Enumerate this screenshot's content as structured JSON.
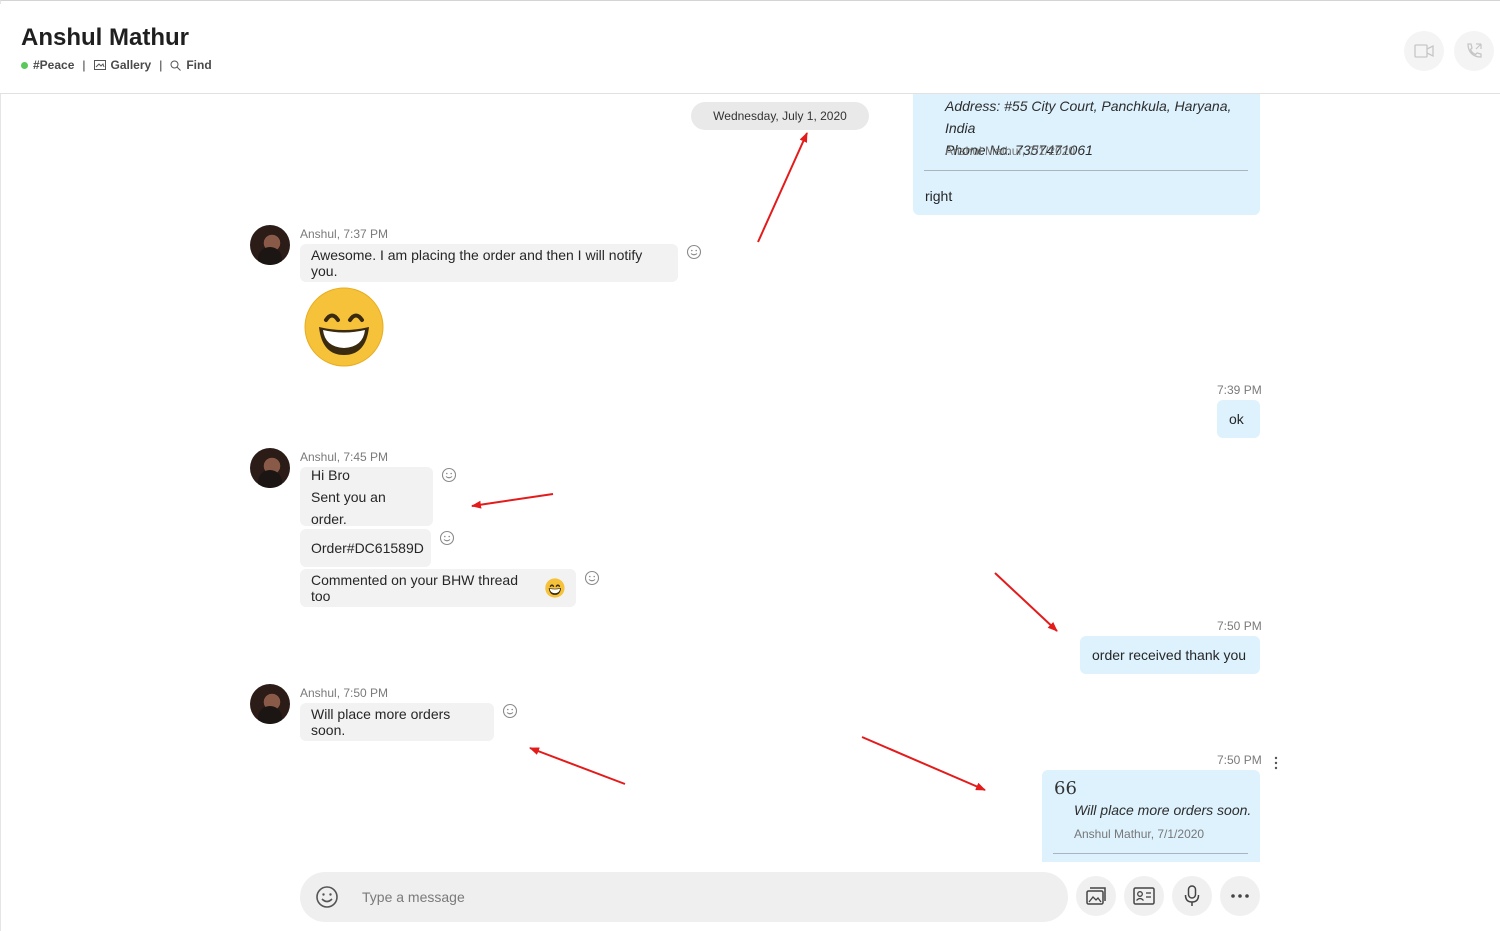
{
  "header": {
    "contact_name": "Anshul Mathur",
    "status_label": "#Peace",
    "gallery_label": "Gallery",
    "find_label": "Find",
    "separator": "|",
    "video_call_icon": "video-camera-icon",
    "audio_call_icon": "phone-icon"
  },
  "conversation": {
    "date_divider": "Wednesday, July 1, 2020",
    "quoted_top": {
      "address_line": "Address: #55 City Court, Panchkula, Haryana, India",
      "phone_line": "Phone No. 7357471061",
      "attribution": "Anshul Mathur, 7/1/2020",
      "reply": "right"
    },
    "msg1": {
      "meta": "Anshul, 7:37 PM",
      "text": "Awesome. I am placing the order and then I will notify you.",
      "emoji": "grinning-face-emoji"
    },
    "out1": {
      "time": "7:39 PM",
      "text": "ok"
    },
    "msg2": {
      "meta": "Anshul, 7:45 PM",
      "line1": "Hi Bro",
      "line2": "Sent you an order.",
      "order": "Order#DC61589D",
      "comment": "Commented on your BHW thread too"
    },
    "out2": {
      "time": "7:50 PM",
      "text": "order received thank you"
    },
    "msg3": {
      "meta": "Anshul, 7:50 PM",
      "text": "Will place more orders soon."
    },
    "out3": {
      "time": "7:50 PM",
      "quote_mark": "66",
      "quoted_text": "Will place more orders soon.",
      "attribution": "Anshul Mathur, 7/1/2020"
    }
  },
  "composer": {
    "placeholder": "Type a message",
    "icons": [
      "smiley-icon",
      "gallery-icon",
      "contact-card-icon",
      "microphone-icon",
      "more-horizontal-icon"
    ]
  },
  "colors": {
    "outgoing_bubble": "#ddf2fd",
    "incoming_bubble": "#f2f2f2",
    "online_dot": "#5ac85a",
    "annotation_arrow": "#e31b1b"
  }
}
